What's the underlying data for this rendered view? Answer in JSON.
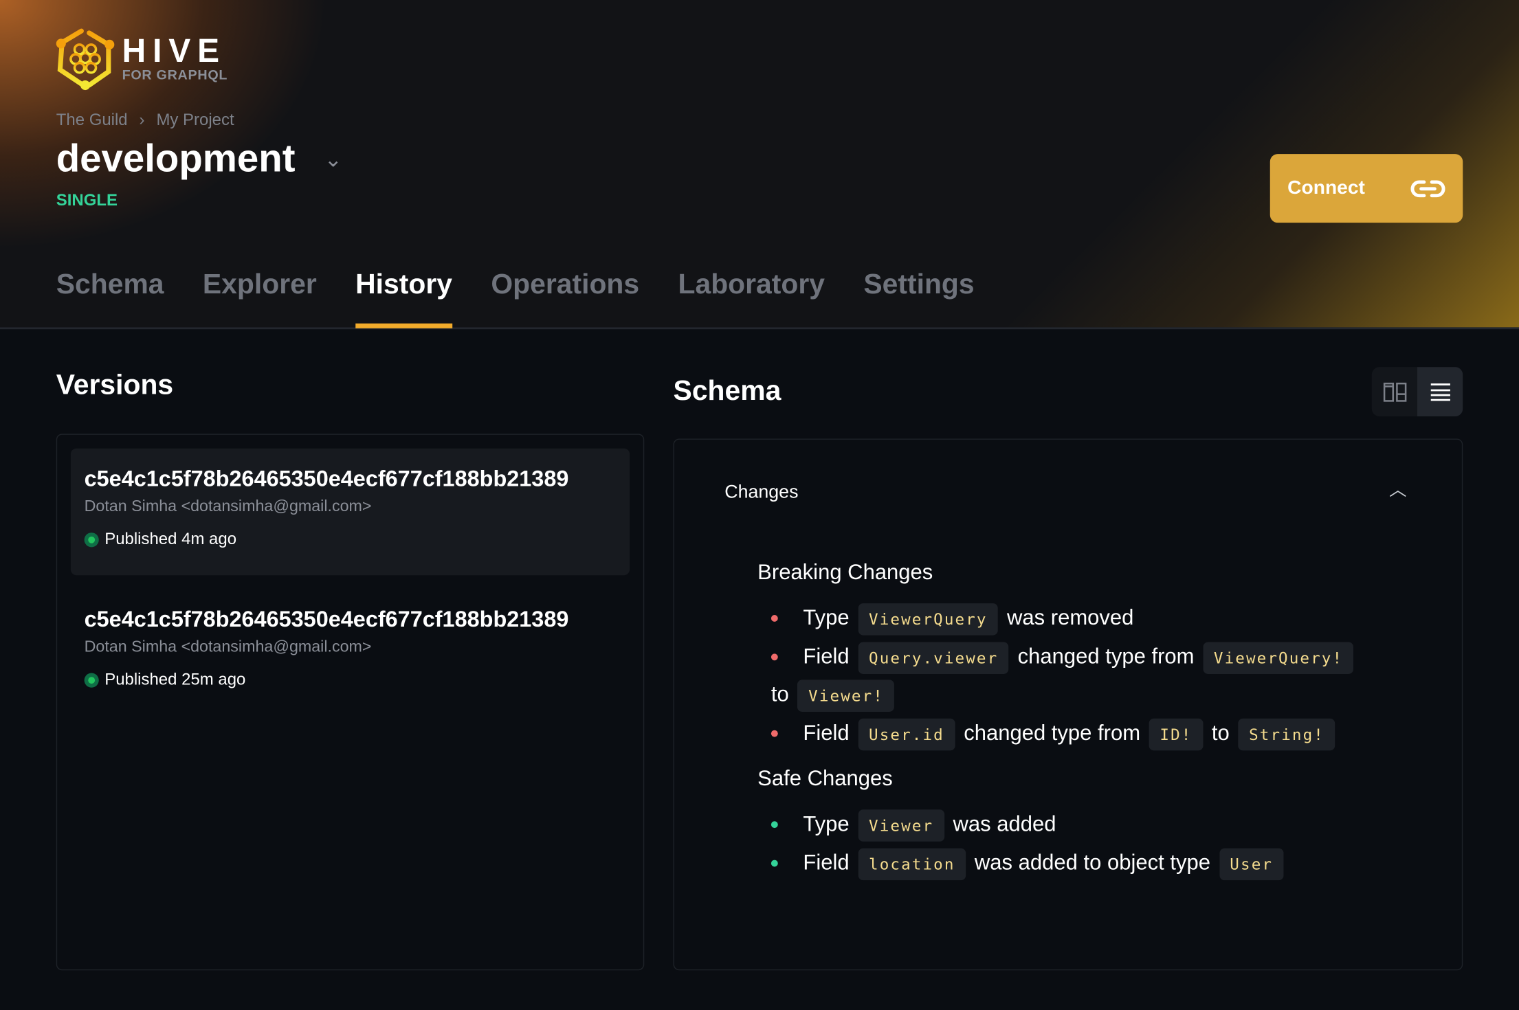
{
  "brand": {
    "name": "HIVE",
    "tagline": "FOR GRAPHQL",
    "accent": "#f2ab2b"
  },
  "breadcrumb": [
    "The Guild",
    "My Project"
  ],
  "target": {
    "name": "development",
    "type": "SINGLE"
  },
  "connect_label": "Connect",
  "tabs": [
    "Schema",
    "Explorer",
    "History",
    "Operations",
    "Laboratory",
    "Settings"
  ],
  "active_tab": "History",
  "versions": {
    "title": "Versions",
    "items": [
      {
        "hash": "c5e4c1c5f78b26465350e4ecf677cf188bb21389",
        "author": "Dotan Simha <dotansimha@gmail.com>",
        "status": "Published 4m ago",
        "selected": true
      },
      {
        "hash": "c5e4c1c5f78b26465350e4ecf677cf188bb21389",
        "author": "Dotan Simha <dotansimha@gmail.com>",
        "status": "Published 25m ago",
        "selected": false
      }
    ]
  },
  "schema": {
    "title": "Schema",
    "view_modes": [
      "split-view-icon",
      "list-view-icon"
    ],
    "active_view": "list",
    "changes_label": "Changes",
    "breaking_title": "Breaking Changes",
    "breaking": [
      [
        "Type",
        "ViewerQuery",
        "was removed"
      ],
      [
        "Field",
        "Query.viewer",
        "changed type from",
        "ViewerQuery!",
        "to",
        "Viewer!"
      ],
      [
        "Field",
        "User.id",
        "changed type from",
        "ID!",
        "to",
        "String!"
      ]
    ],
    "safe_title": "Safe Changes",
    "safe": [
      [
        "Type",
        "Viewer",
        "was added"
      ],
      [
        "Field",
        "location",
        "was added to object type",
        "User"
      ]
    ]
  }
}
